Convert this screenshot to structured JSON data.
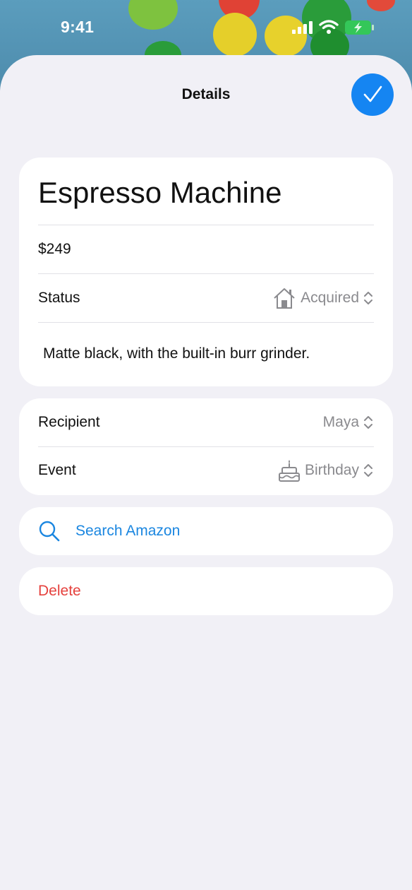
{
  "status_bar": {
    "time": "9:41"
  },
  "header": {
    "title": "Details",
    "done_icon": "checkmark-icon"
  },
  "item": {
    "name": "Espresso Machine",
    "price": "$249",
    "status_label": "Status",
    "status_value": "Acquired",
    "status_icon": "house-icon",
    "notes": "Matte black, with the built-in burr grinder."
  },
  "details": {
    "recipient_label": "Recipient",
    "recipient_value": "Maya",
    "event_label": "Event",
    "event_value": "Birthday",
    "event_icon": "birthday-cake-icon"
  },
  "actions": {
    "search_label": "Search Amazon",
    "delete_label": "Delete"
  },
  "colors": {
    "accent": "#1585f2",
    "link": "#1a86e0",
    "destructive": "#e5413d",
    "sheet_bg": "#f1f0f6"
  }
}
